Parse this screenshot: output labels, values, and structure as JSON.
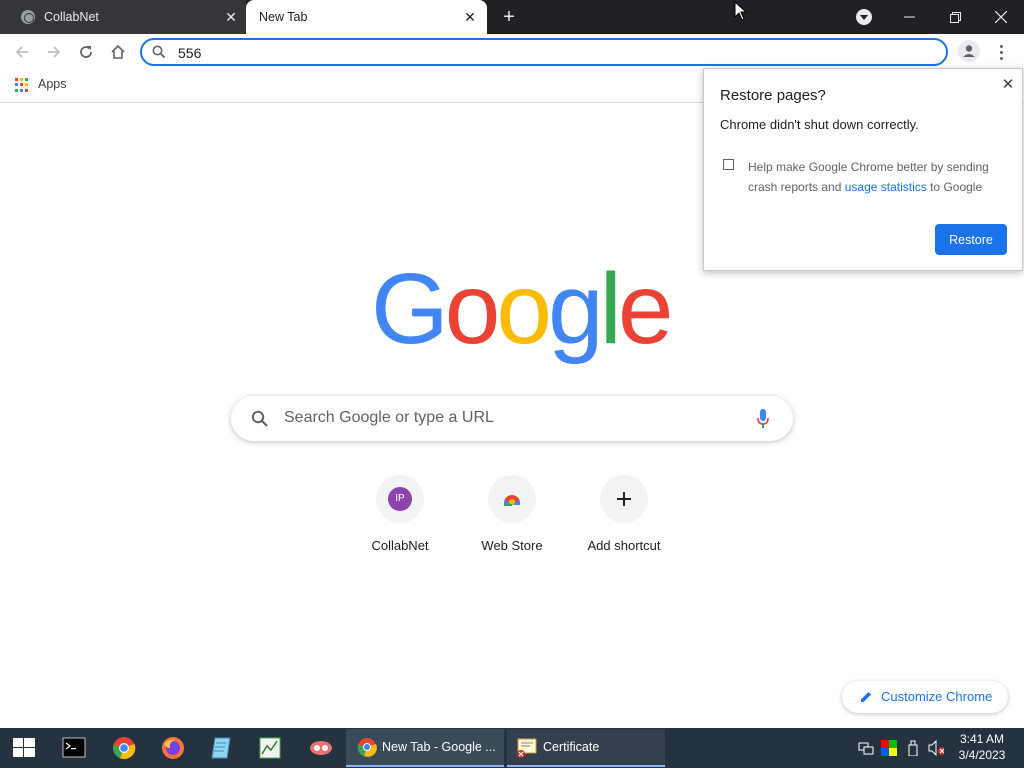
{
  "tabs": [
    {
      "title": "CollabNet",
      "active": false
    },
    {
      "title": "New Tab",
      "active": true
    }
  ],
  "omnibox": {
    "value": "556"
  },
  "bookmarks": {
    "apps_label": "Apps"
  },
  "google_logo": {
    "letters": [
      "G",
      "o",
      "o",
      "g",
      "l",
      "e"
    ],
    "colors": [
      "#4285f4",
      "#ea4335",
      "#fbbc05",
      "#4285f4",
      "#34a853",
      "#ea4335"
    ]
  },
  "search": {
    "placeholder": "Search Google or type a URL"
  },
  "shortcuts": [
    {
      "label": "CollabNet",
      "badge": "IP",
      "badge_color": "#8e44ad"
    },
    {
      "label": "Web Store"
    },
    {
      "label": "Add shortcut"
    }
  ],
  "customize": {
    "label": "Customize Chrome"
  },
  "restore_popup": {
    "title": "Restore pages?",
    "message": "Chrome didn't shut down correctly.",
    "checkbox_text_before": "Help make Google Chrome better by sending crash reports and ",
    "checkbox_link": "usage statistics",
    "checkbox_text_after": " to Google",
    "restore_label": "Restore"
  },
  "taskbar": {
    "tasks": [
      {
        "label": "New Tab - Google ..."
      },
      {
        "label": "Certificate"
      }
    ],
    "clock_time": "3:41 AM",
    "clock_date": "3/4/2023"
  },
  "colors": {
    "accent": "#1a73e8",
    "taskbar": "#253341",
    "tabstrip": "#202124"
  }
}
